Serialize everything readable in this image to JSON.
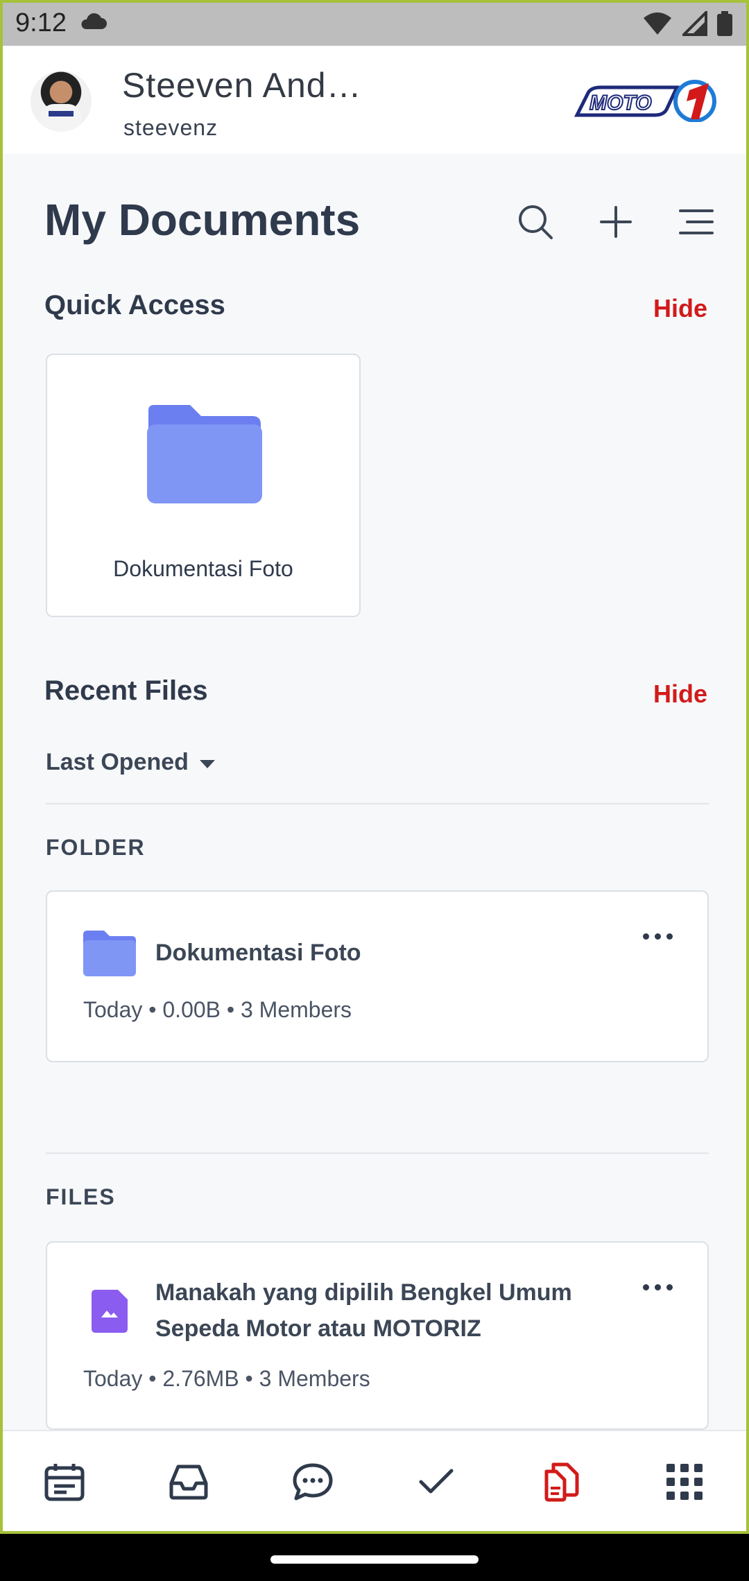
{
  "status_bar": {
    "time": "9:12"
  },
  "header": {
    "user_name": "Steeven And…",
    "user_handle": "steevenz",
    "brand_text": "MOTO1"
  },
  "page": {
    "title": "My Documents"
  },
  "quick_access": {
    "title": "Quick Access",
    "hide_label": "Hide",
    "items": [
      {
        "label": "Dokumentasi Foto"
      }
    ]
  },
  "recent_files": {
    "title": "Recent Files",
    "hide_label": "Hide",
    "sort_label": "Last Opened",
    "folder_section": {
      "heading": "FOLDER",
      "items": [
        {
          "name": "Dokumentasi Foto",
          "date": "Today",
          "size": "0.00B",
          "members": "3 Members"
        }
      ]
    },
    "files_section": {
      "heading": "FILES",
      "items": [
        {
          "name_line1": "Manakah yang dipilih Bengkel Umum",
          "name_line2": "Sepeda Motor atau MOTORIZ",
          "date": "Today",
          "size": "2.76MB",
          "members": "3 Members"
        }
      ]
    }
  },
  "bottom_nav": {
    "items": [
      "calendar-icon",
      "inbox-icon",
      "chat-icon",
      "check-icon",
      "documents-icon",
      "apps-grid-icon"
    ],
    "active": "documents-icon",
    "active_color": "#d21a1a"
  },
  "colors": {
    "accent": "#d21a1a",
    "folder": "#7f96f5",
    "text_dark": "#2f3a4c",
    "image_file": "#8a5cf0"
  }
}
